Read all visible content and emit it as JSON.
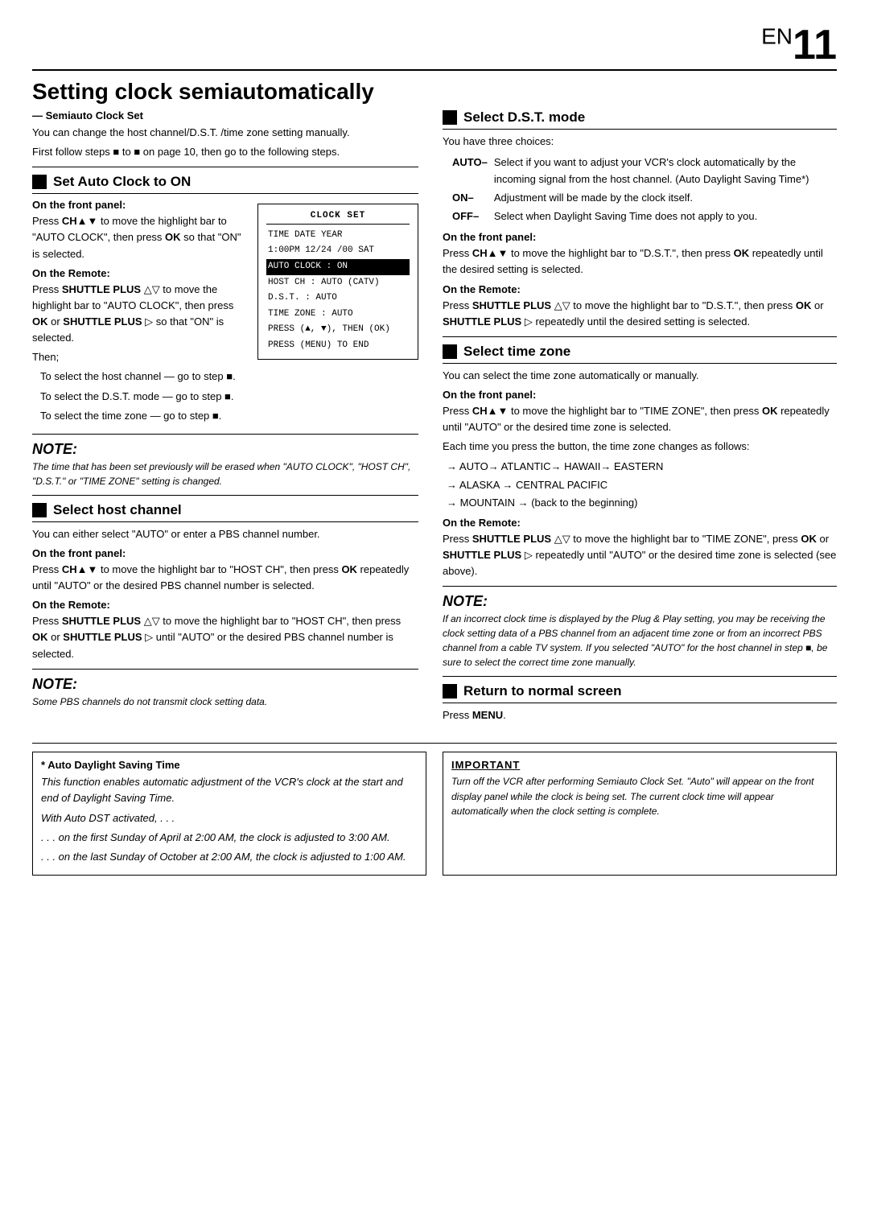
{
  "page": {
    "en_label": "EN",
    "page_number": "11",
    "title": "Setting clock semiautomatically",
    "subtitle": "— Semiauto Clock Set",
    "intro1": "You can change the host channel/D.S.T. /time zone setting manually.",
    "intro2": "First follow steps",
    "intro2b": "to",
    "intro2c": "on page 10, then go to the following steps."
  },
  "set_auto_clock": {
    "heading": "Set Auto Clock to ON",
    "front_panel_label": "On the front panel:",
    "front_panel_text": "Press CH▲▼ to move the highlight bar to \"AUTO CLOCK\", then press OK so that \"ON\" is selected.",
    "remote_label": "On the Remote:",
    "remote_text1": "Press SHUTTLE PLUS △▽ to move the highlight bar to \"AUTO CLOCK\", then press OK or SHUTTLE PLUS ▷ so that \"ON\" is selected.",
    "remote_then": "Then;",
    "step1": "To select the host channel — go to step",
    "step2": "To select the D.S.T. mode — go to step",
    "step3": "To select the time zone — go to step",
    "clock_box": {
      "title": "CLOCK SET",
      "line1": "TIME    DATE  YEAR",
      "line2": "1:00PM  12/24  /00 SAT",
      "line3": "AUTO CLOCK : ON",
      "line4": "HOST CH    : AUTO (CATV)",
      "line5": "D.S.T.     : AUTO",
      "line6": "TIME ZONE  : AUTO",
      "line7": "PRESS (▲, ▼), THEN (OK)",
      "line8": "PRESS (MENU) TO END"
    }
  },
  "note1": {
    "title": "NOTE:",
    "text": "The time that has been set previously will be erased when \"AUTO CLOCK\", \"HOST CH\", \"D.S.T.\" or \"TIME ZONE\" setting is changed."
  },
  "select_host_channel": {
    "heading": "Select host channel",
    "intro": "You can either select \"AUTO\" or enter a PBS channel number.",
    "front_panel_label": "On the front panel:",
    "front_panel_text": "Press CH▲▼ to move the highlight bar to \"HOST CH\", then press OK repeatedly until \"AUTO\" or the desired PBS channel number is selected.",
    "remote_label": "On the Remote:",
    "remote_text": "Press SHUTTLE PLUS △▽ to move the highlight bar to \"HOST CH\", then press OK or SHUTTLE PLUS ▷ until \"AUTO\" or the desired PBS channel number is selected."
  },
  "note2": {
    "title": "NOTE:",
    "text": "Some PBS channels do not transmit clock setting data."
  },
  "select_dst": {
    "heading": "Select D.S.T. mode",
    "intro": "You have three choices:",
    "auto_label": "AUTO–",
    "auto_text": "Select if you want to adjust your VCR's clock automatically by the incoming signal from the host channel. (Auto Daylight Saving Time*)",
    "on_label": "ON–",
    "on_text": "Adjustment will be made by the clock itself.",
    "off_label": "OFF–",
    "off_text": "Select when Daylight Saving Time does not apply to you.",
    "front_panel_label": "On the front panel:",
    "front_panel_text": "Press CH▲▼ to move the highlight bar to \"D.S.T.\", then press OK repeatedly until the desired setting is selected.",
    "remote_label": "On the Remote:",
    "remote_text": "Press SHUTTLE PLUS △▽ to move the highlight bar to \"D.S.T.\", then press OK or SHUTTLE PLUS ▷ repeatedly until the desired setting is selected."
  },
  "select_time_zone": {
    "heading": "Select time zone",
    "intro": "You can select the time zone automatically or manually.",
    "front_panel_label": "On the front panel:",
    "front_panel_text": "Press CH▲▼ to move the highlight bar to \"TIME ZONE\", then press OK repeatedly until \"AUTO\" or the desired time zone is selected.",
    "front_panel_text2": "Each time you press the button, the time zone changes as follows:",
    "zones": [
      "→ AUTO→ ATLANTIC→ HAWAII→ EASTERN",
      "→ ALASKA → CENTRAL PACIFIC",
      "→ MOUNTAIN → (back to the beginning)"
    ],
    "remote_label": "On the Remote:",
    "remote_text": "Press SHUTTLE PLUS △▽ to move the highlight bar to \"TIME ZONE\", press OK or SHUTTLE PLUS ▷ repeatedly until \"AUTO\" or the desired time zone is selected (see above)."
  },
  "note3": {
    "title": "NOTE:",
    "text": "If an incorrect clock time is displayed by the Plug & Play setting, you may be receiving the clock setting data of a PBS channel from an adjacent time zone or from an incorrect PBS channel from a cable TV system. If you selected \"AUTO\" for the host channel in step ■, be sure to select the correct time zone manually."
  },
  "return_to_normal": {
    "heading": "Return to normal screen",
    "text": "Press MENU."
  },
  "auto_dst": {
    "title": "* Auto Daylight Saving Time",
    "text1": "This function enables automatic adjustment of the VCR's clock at the start and end of Daylight Saving Time.",
    "text2": "With Auto DST activated, . . .",
    "text3": ". . .   on the first Sunday of April at 2:00 AM, the clock is adjusted to 3:00 AM.",
    "text4": ". . .   on the last Sunday of October at 2:00 AM, the clock is adjusted to 1:00 AM."
  },
  "important": {
    "title": "IMPORTANT",
    "text": "Turn off the VCR after performing Semiauto Clock Set. \"Auto\" will appear on the front display panel while the clock is being set. The current clock time will appear automatically when the clock setting is complete."
  }
}
